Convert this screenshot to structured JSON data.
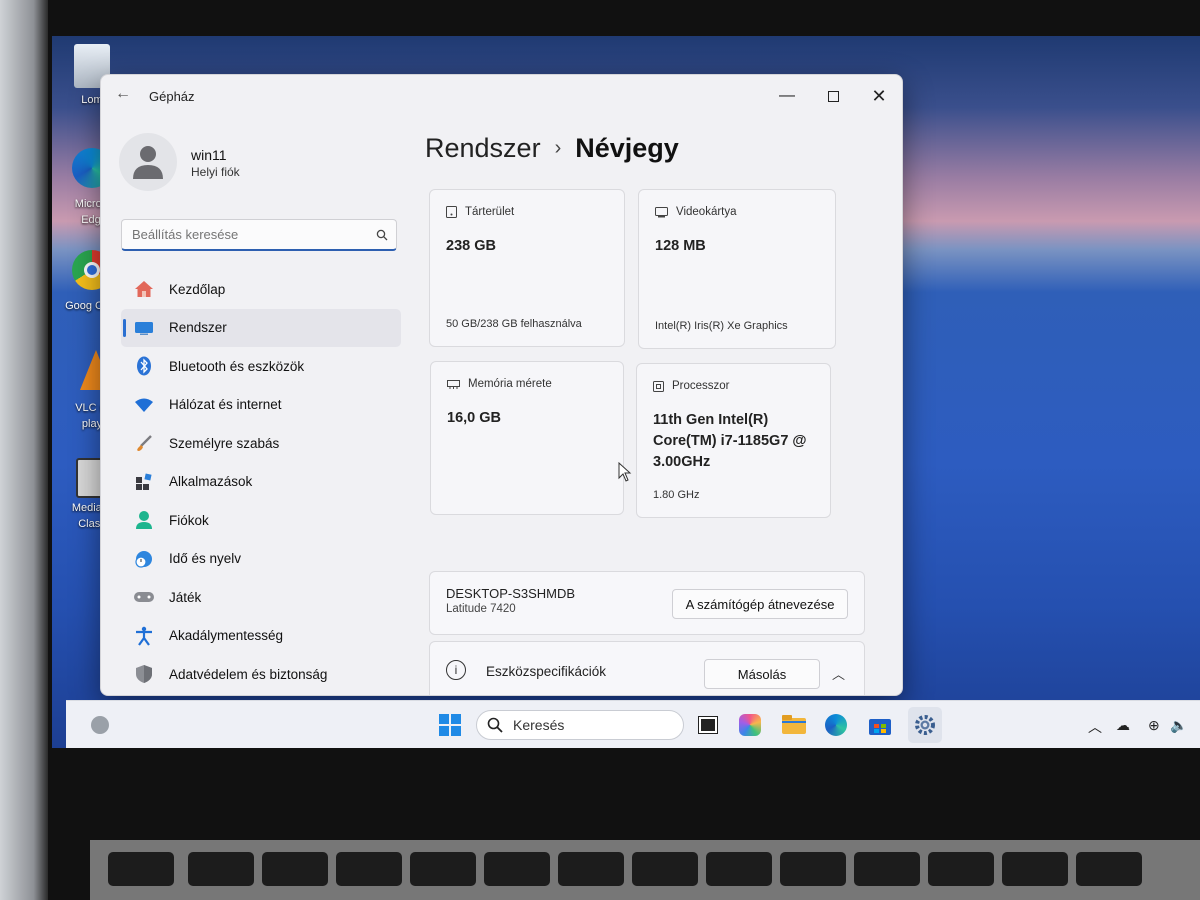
{
  "window": {
    "title": "Gépház"
  },
  "account": {
    "name": "win11",
    "type": "Helyi fiók"
  },
  "search": {
    "placeholder": "Beállítás keresése"
  },
  "nav": {
    "items": [
      {
        "label": "Kezdőlap",
        "icon": "home-icon"
      },
      {
        "label": "Rendszer",
        "icon": "display-icon",
        "active": true
      },
      {
        "label": "Bluetooth és eszközök",
        "icon": "bluetooth-icon"
      },
      {
        "label": "Hálózat és internet",
        "icon": "wifi-icon"
      },
      {
        "label": "Személyre szabás",
        "icon": "brush-icon"
      },
      {
        "label": "Alkalmazások",
        "icon": "apps-icon"
      },
      {
        "label": "Fiókok",
        "icon": "person-icon"
      },
      {
        "label": "Idő és nyelv",
        "icon": "clock-globe-icon"
      },
      {
        "label": "Játék",
        "icon": "gamepad-icon"
      },
      {
        "label": "Akadálymentesség",
        "icon": "accessibility-icon"
      },
      {
        "label": "Adatvédelem és biztonság",
        "icon": "shield-icon"
      }
    ]
  },
  "breadcrumb": {
    "parent": "Rendszer",
    "separator": "›",
    "current": "Névjegy"
  },
  "specs": {
    "storage": {
      "title": "Tárterület",
      "value": "238 GB",
      "foot": "50 GB/238 GB felhasználva"
    },
    "gpu": {
      "title": "Videokártya",
      "value": "128 MB",
      "foot": "Intel(R) Iris(R) Xe Graphics"
    },
    "memory": {
      "title": "Memória mérete",
      "value": "16,0 GB"
    },
    "cpu": {
      "title": "Processzor",
      "value_line1": "11th Gen Intel(R)",
      "value_line2": "Core(TM) i7-1185G7 @",
      "value_line3": "3.00GHz",
      "foot": "1.80 GHz"
    }
  },
  "device": {
    "name": "DESKTOP-S3SHMDB",
    "model": "Latitude 7420",
    "rename_label": "A számítógép átnevezése"
  },
  "device_specs": {
    "title": "Eszközspecifikációk",
    "copy_label": "Másolás"
  },
  "taskbar": {
    "search_label": "Keresés"
  },
  "desktop": {
    "icons": [
      "Lom",
      "Micros Edg",
      "Goog Chro",
      "VLC m play",
      "Media P Class"
    ]
  },
  "colors": {
    "accent": "#2a6fd1",
    "window_bg": "#f1f1f4"
  }
}
